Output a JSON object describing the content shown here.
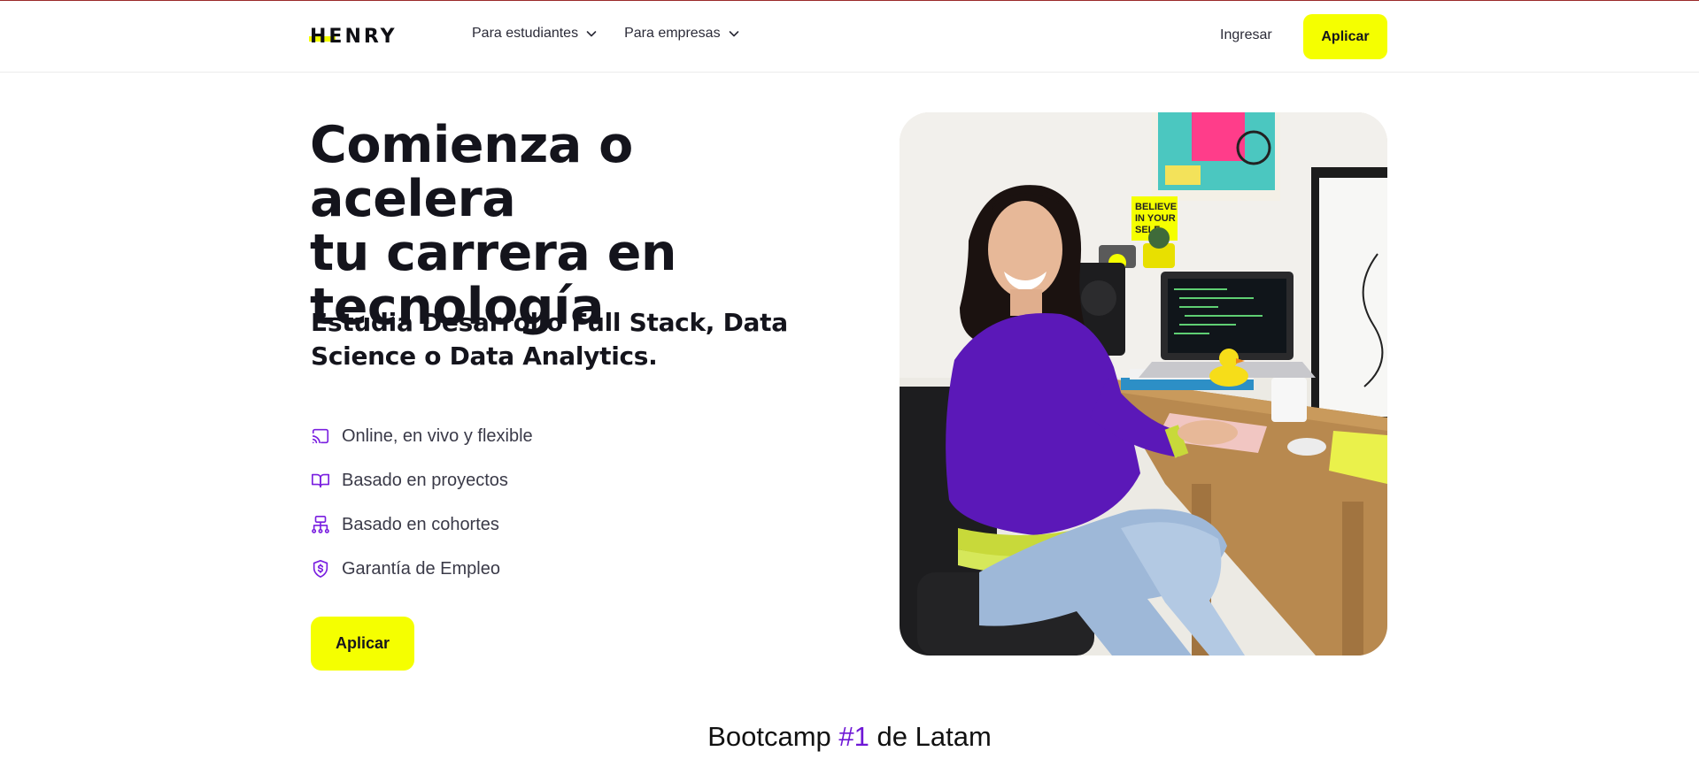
{
  "brand": {
    "logo_text": "HENRY",
    "accent_color": "#f5ff00",
    "purple": "#6f18d6"
  },
  "nav": {
    "items": [
      {
        "label": "Para estudiantes",
        "icon": "chevron-down-icon"
      },
      {
        "label": "Para empresas",
        "icon": "chevron-down-icon"
      }
    ],
    "login_label": "Ingresar",
    "apply_label": "Aplicar"
  },
  "hero": {
    "title_lines": [
      "Comienza o acelera",
      "tu carrera en",
      "tecnología"
    ],
    "subtitle": "Estudia Desarrollo Full Stack, Data Science o Data Analytics.",
    "features": [
      {
        "icon": "cast-icon",
        "label": "Online, en vivo y flexible"
      },
      {
        "icon": "book-icon",
        "label": "Basado en proyectos"
      },
      {
        "icon": "cohorts-icon",
        "label": "Basado en cohortes"
      },
      {
        "icon": "shield-dollar-icon",
        "label": "Garantía de Empleo"
      }
    ],
    "cta_label": "Aplicar",
    "image_poster_text": [
      "BELIEVE",
      "IN YOUR",
      "SELF"
    ]
  },
  "ranking": {
    "prefix": "Bootcamp ",
    "highlight": "#1",
    "suffix": " de Latam"
  }
}
